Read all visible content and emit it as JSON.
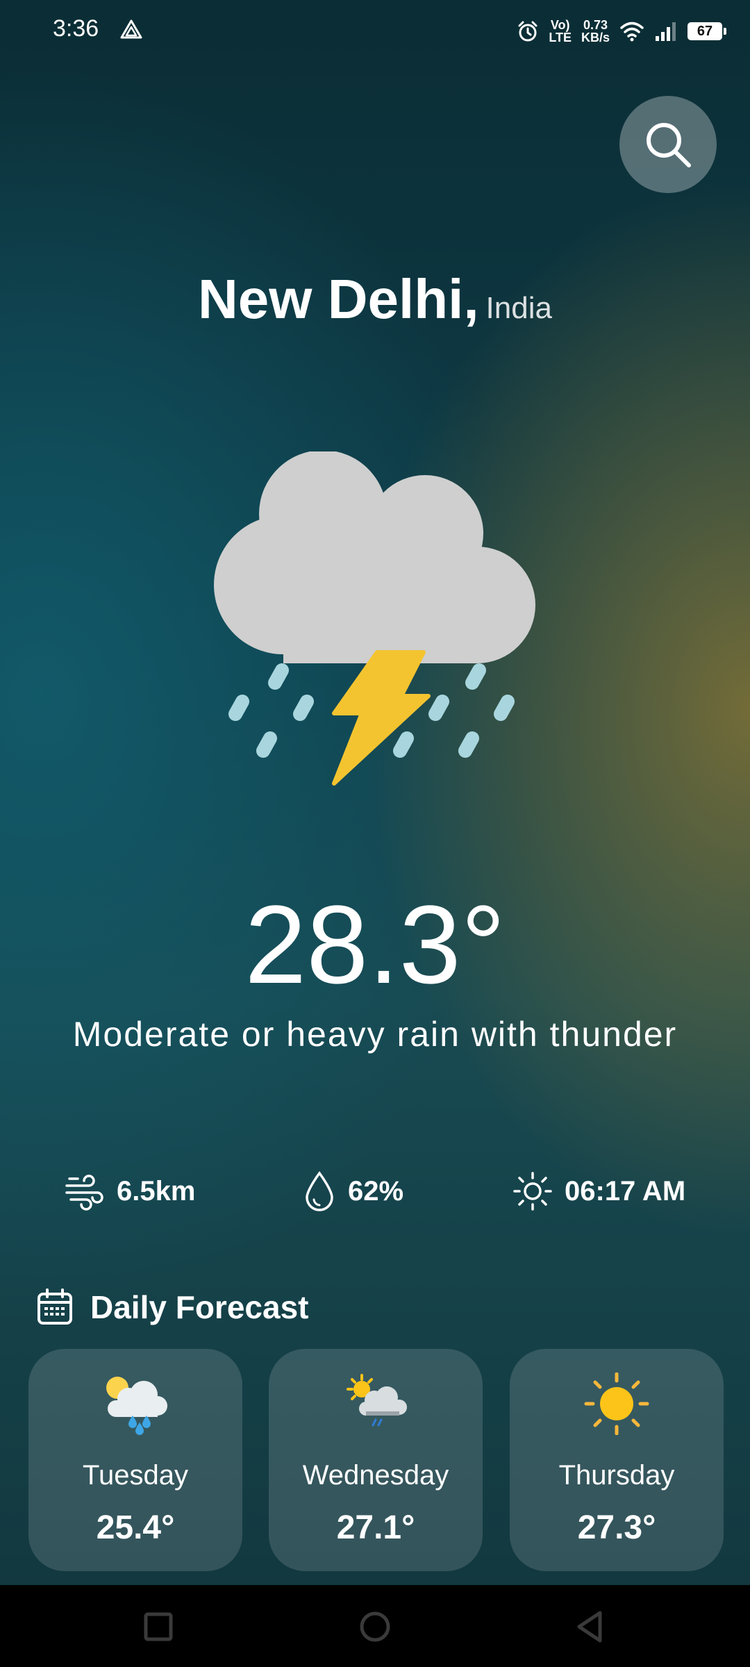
{
  "status_bar": {
    "time": "3:36",
    "network_label_top": "Vo)",
    "network_label_bottom": "LTE",
    "speed_value": "0.73",
    "speed_unit": "KB/s",
    "battery": "67"
  },
  "header": {
    "search_icon": "search-icon",
    "city": "New Delhi,",
    "country": "India"
  },
  "current": {
    "icon": "thunderstorm-rain-icon",
    "temperature": "28.3°",
    "condition": "Moderate or heavy rain with thunder"
  },
  "stats": {
    "wind": {
      "icon": "wind-icon",
      "value": "6.5km"
    },
    "humidity": {
      "icon": "droplet-icon",
      "value": "62%"
    },
    "sunrise": {
      "icon": "sun-icon",
      "value": "06:17 AM"
    }
  },
  "forecast": {
    "icon": "calendar-icon",
    "title": "Daily Forecast",
    "days": [
      {
        "day": "Tuesday",
        "temp": "25.4°",
        "icon": "sun-cloud-rain-icon"
      },
      {
        "day": "Wednesday",
        "temp": "27.1°",
        "icon": "sun-cloud-drizzle-icon"
      },
      {
        "day": "Thursday",
        "temp": "27.3°",
        "icon": "sun-icon"
      }
    ]
  },
  "colors": {
    "cloud": "#cfcfcf",
    "bolt": "#f4c430",
    "rain": "#a9d6de",
    "sun": "#fcc419"
  },
  "nav": {
    "recents": "square-icon",
    "home": "circle-icon",
    "back": "triangle-back-icon"
  }
}
